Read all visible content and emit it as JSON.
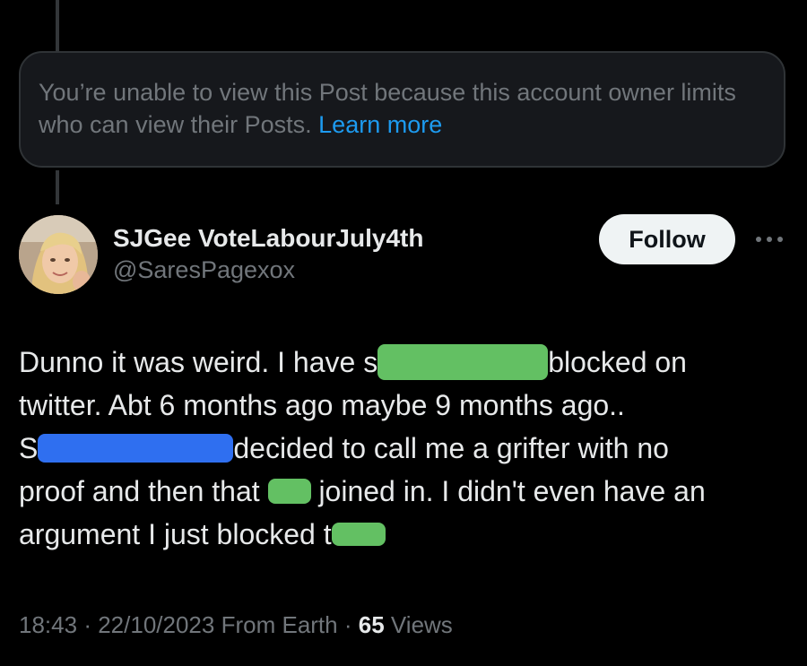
{
  "unavailable_notice": {
    "message": "You’re unable to view this Post because this account owner limits who can view their Posts.",
    "learn_more": "Learn more"
  },
  "author": {
    "display_name": "SJGee VoteLabourJuly4th",
    "handle": "@SaresPagexox"
  },
  "follow_label": "Follow",
  "post": {
    "line1_before": "Dunno it was weird. I have s",
    "line1_after": "blocked on",
    "line2": "twitter. Abt 6 months ago maybe 9 months ago..",
    "line3_before": "S",
    "line3_after": "decided to call me a grifter with no",
    "line4_before": "proof and then that ",
    "line4_after": " joined in. I didn't even have an",
    "line5": "argument I just blocked ",
    "line5_tail": "t"
  },
  "meta": {
    "time": "18:43",
    "date": "22/10/2023",
    "source": "From Earth",
    "views_count": "65",
    "views_label": "Views"
  },
  "colors": {
    "background": "#000000",
    "text_primary": "#e7e9ea",
    "text_secondary": "#71767b",
    "link": "#1d9bf0",
    "redaction_green": "#63c063",
    "redaction_blue": "#2f6ff0"
  }
}
